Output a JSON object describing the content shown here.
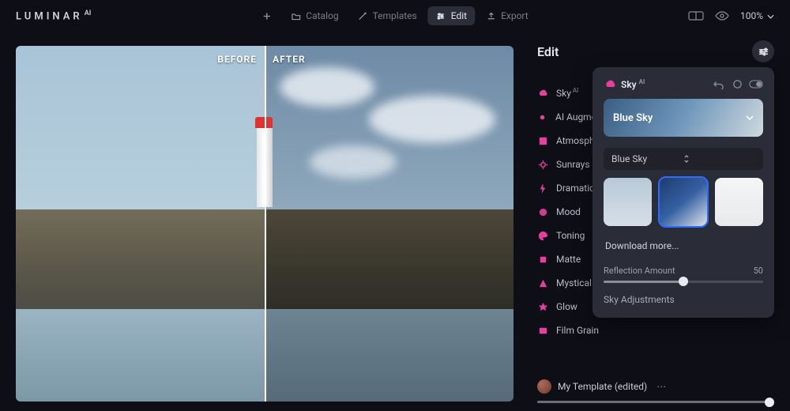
{
  "app": {
    "brand": "LUMINAR",
    "brand_suffix": "AI",
    "zoom": "100%"
  },
  "nav": {
    "add_label": "",
    "catalog": "Catalog",
    "templates": "Templates",
    "edit": "Edit",
    "export": "Export",
    "active": "edit"
  },
  "canvas": {
    "before_label": "BEFORE",
    "after_label": "AFTER"
  },
  "panel": {
    "title": "Edit"
  },
  "effects": [
    {
      "id": "sky",
      "label": "Sky",
      "suffix": "AI",
      "color": "#e53fa0"
    },
    {
      "id": "augmented",
      "label": "AI Augmented",
      "color": "#e53fa0"
    },
    {
      "id": "atmosphere",
      "label": "Atmosphere",
      "color": "#e53fa0"
    },
    {
      "id": "sunrays",
      "label": "Sunrays",
      "color": "#e53fa0"
    },
    {
      "id": "dramatic",
      "label": "Dramatic",
      "color": "#e53fa0"
    },
    {
      "id": "mood",
      "label": "Mood",
      "color": "#e53fa0"
    },
    {
      "id": "toning",
      "label": "Toning",
      "color": "#e53fa0"
    },
    {
      "id": "matte",
      "label": "Matte",
      "color": "#e53fa0"
    },
    {
      "id": "mystical",
      "label": "Mystical",
      "color": "#e53fa0"
    },
    {
      "id": "glow",
      "label": "Glow",
      "color": "#e53fa0"
    },
    {
      "id": "filmgrain",
      "label": "Film Grain",
      "color": "#e53fa0"
    }
  ],
  "sky_panel": {
    "title": "Sky",
    "title_suffix": "AI",
    "preset_name": "Blue Sky",
    "select_value": "Blue Sky",
    "download_more": "Download more...",
    "reflection_label": "Reflection Amount",
    "reflection_value": 50,
    "adjustments": "Sky Adjustments",
    "thumbs": [
      "light-clouds",
      "blue-sky",
      "overcast"
    ],
    "selected_thumb": 1
  },
  "template_bar": {
    "name": "My Template (edited)",
    "amount": 100
  }
}
